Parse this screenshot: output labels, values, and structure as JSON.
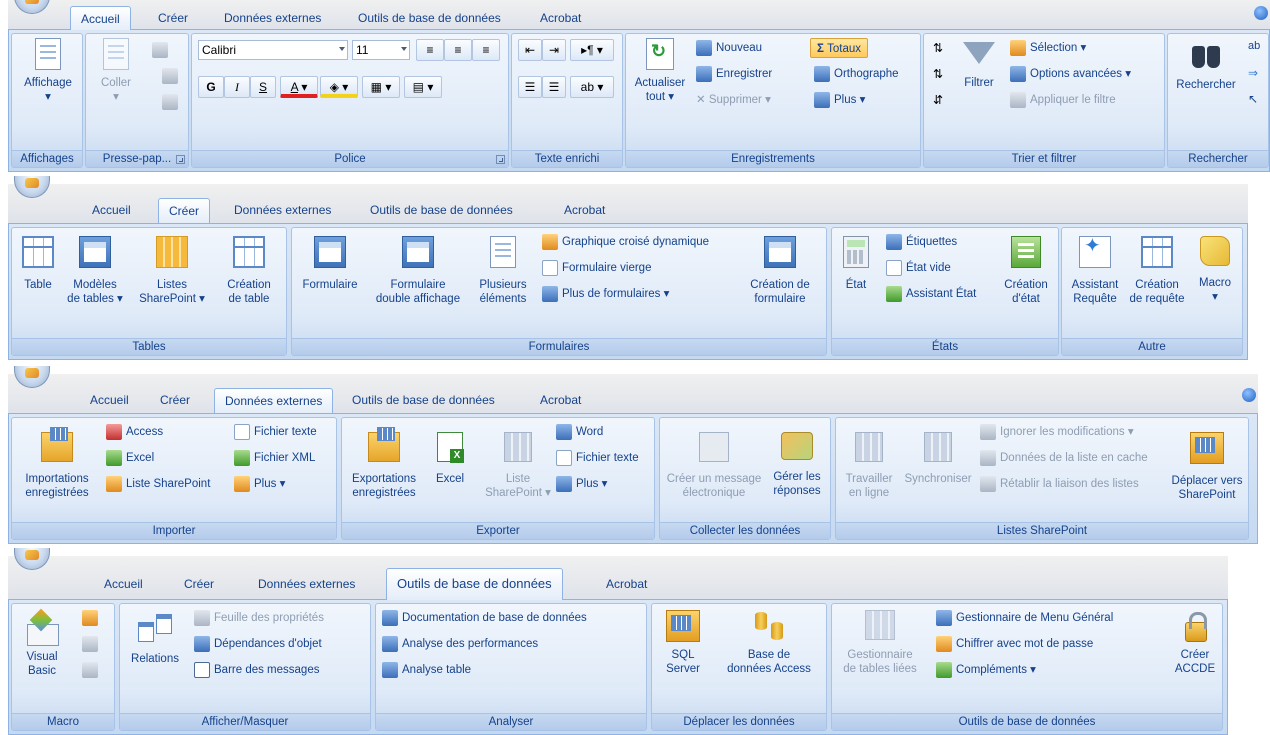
{
  "tabs": [
    "Accueil",
    "Créer",
    "Données externes",
    "Outils de base de données",
    "Acrobat"
  ],
  "accueil": {
    "affichage": {
      "label": "Affichage",
      "group": "Affichages"
    },
    "presse": {
      "coller": "Coller",
      "group": "Presse-pap..."
    },
    "police": {
      "font": "Calibri",
      "size": "11",
      "bold": "G",
      "italic": "I",
      "underline": "S",
      "fontcolor": "A",
      "group": "Police"
    },
    "texte": {
      "group": "Texte enrichi"
    },
    "enreg": {
      "actualiser_l1": "Actualiser",
      "actualiser_l2": "tout ▾",
      "nouveau": "Nouveau",
      "enregistrer": "Enregistrer",
      "supprimer": "Supprimer ▾",
      "totaux": "Totaux",
      "orthographe": "Orthographe",
      "plus": "Plus ▾",
      "group": "Enregistrements"
    },
    "trier": {
      "filtrer": "Filtrer",
      "selection": "Sélection ▾",
      "options": "Options avancées ▾",
      "appliquer": "Appliquer le filtre",
      "group": "Trier et filtrer"
    },
    "rechercher": {
      "label": "Rechercher",
      "group": "Rechercher"
    }
  },
  "creer": {
    "tables": {
      "table": "Table",
      "modeles_l1": "Modèles",
      "modeles_l2": "de tables ▾",
      "listes_l1": "Listes",
      "listes_l2": "SharePoint ▾",
      "creation_l1": "Création",
      "creation_l2": "de table",
      "group": "Tables"
    },
    "formulaires": {
      "formulaire": "Formulaire",
      "double_l1": "Formulaire",
      "double_l2": "double affichage",
      "plusieurs_l1": "Plusieurs",
      "plusieurs_l2": "éléments",
      "graphique": "Graphique croisé dynamique",
      "vierge": "Formulaire vierge",
      "plus_form": "Plus de formulaires ▾",
      "creation_l1": "Création de",
      "creation_l2": "formulaire",
      "group": "Formulaires"
    },
    "etats": {
      "etat": "État",
      "etiquettes": "Étiquettes",
      "vide": "État vide",
      "assistant": "Assistant État",
      "creation_l1": "Création",
      "creation_l2": "d'état",
      "group": "États"
    },
    "autre": {
      "assistant_l1": "Assistant",
      "assistant_l2": "Requête",
      "creation_l1": "Création",
      "creation_l2": "de requête",
      "macro": "Macro",
      "macro_arrow": "▾",
      "group": "Autre"
    }
  },
  "externes": {
    "importer": {
      "import_l1": "Importations",
      "import_l2": "enregistrées",
      "access": "Access",
      "excel": "Excel",
      "sharepoint": "Liste SharePoint",
      "fichier_texte": "Fichier texte",
      "fichier_xml": "Fichier XML",
      "plus": "Plus ▾",
      "group": "Importer"
    },
    "exporter": {
      "export_l1": "Exportations",
      "export_l2": "enregistrées",
      "excel": "Excel",
      "liste_l1": "Liste",
      "liste_l2": "SharePoint ▾",
      "word": "Word",
      "fichier_texte": "Fichier texte",
      "plus": "Plus ▾",
      "group": "Exporter"
    },
    "collecter": {
      "creer_l1": "Créer un message",
      "creer_l2": "électronique",
      "gerer_l1": "Gérer les",
      "gerer_l2": "réponses",
      "group": "Collecter les données"
    },
    "listes": {
      "travailler_l1": "Travailler",
      "travailler_l2": "en ligne",
      "synchroniser": "Synchroniser",
      "ignorer": "Ignorer les modifications ▾",
      "donnees_cache": "Données de la liste en cache",
      "retablir": "Rétablir la liaison des listes",
      "deplacer_l1": "Déplacer vers",
      "deplacer_l2": "SharePoint",
      "group": "Listes SharePoint"
    }
  },
  "outils": {
    "macro": {
      "vb_l1": "Visual",
      "vb_l2": "Basic",
      "group": "Macro"
    },
    "afficher": {
      "relations": "Relations",
      "feuille": "Feuille des propriétés",
      "dependances": "Dépendances d'objet",
      "barre": "Barre des messages",
      "group": "Afficher/Masquer"
    },
    "analyser": {
      "documentation": "Documentation de base de données",
      "performances": "Analyse des performances",
      "table": "Analyse table",
      "group": "Analyser"
    },
    "deplacer": {
      "sql_l1": "SQL",
      "sql_l2": "Server",
      "access_l1": "Base de",
      "access_l2": "données Access",
      "group": "Déplacer les données"
    },
    "outils_bd": {
      "gestionnaire_l1": "Gestionnaire",
      "gestionnaire_l2": "de tables liées",
      "menu": "Gestionnaire de Menu Général",
      "chiffrer": "Chiffrer avec mot de passe",
      "complements": "Compléments ▾",
      "accde_l1": "Créer",
      "accde_l2": "ACCDE",
      "group": "Outils de base de données"
    }
  }
}
